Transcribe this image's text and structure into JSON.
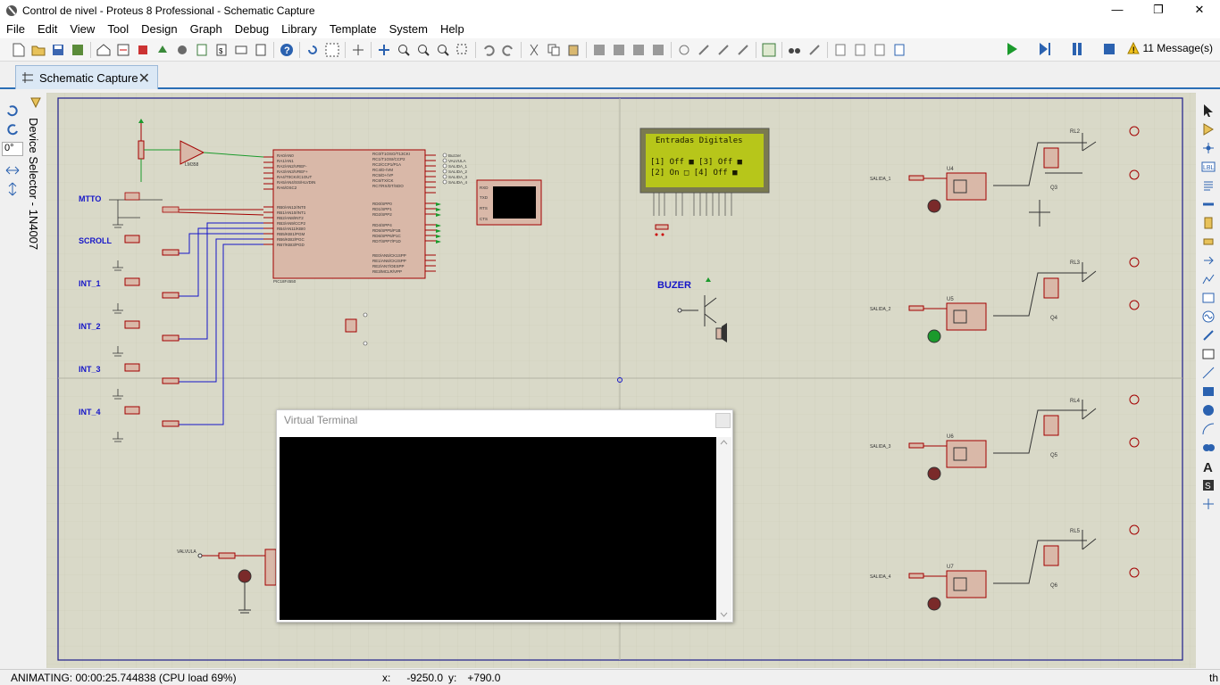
{
  "window": {
    "title": "Control de nivel - Proteus 8 Professional - Schematic Capture",
    "controls": {
      "minimize": "—",
      "restore": "❐",
      "close": "✕"
    }
  },
  "menu": [
    "File",
    "Edit",
    "View",
    "Tool",
    "Design",
    "Graph",
    "Debug",
    "Library",
    "Template",
    "System",
    "Help"
  ],
  "messages": {
    "label": "11 Message(s)"
  },
  "tab": {
    "label": "Schematic Capture"
  },
  "device_selector": {
    "label": "Device Selector - 1N4007"
  },
  "rotation": {
    "value": "0°"
  },
  "schematic": {
    "inputs": [
      "MTTO",
      "SCROLL",
      "INT_1",
      "INT_2",
      "INT_3",
      "INT_4"
    ],
    "buzzer_label": "BUZER",
    "lcd": {
      "line1": "Entradas Digitales",
      "line3": "[1] Off ■  [3] Off ■",
      "line4": "[2] On  □  [4] Off ■"
    },
    "mcu": {
      "name": "PIC18F4550"
    },
    "opamp": {
      "name": "LM358"
    },
    "relays": [
      "RL2",
      "RL3",
      "RL4",
      "RL5"
    ],
    "optos": [
      "U4",
      "U5",
      "U6",
      "U7"
    ],
    "transistors": [
      "Q3",
      "Q4",
      "Q5",
      "Q6"
    ],
    "outputs": [
      "SALIDA_1",
      "SALIDA_2",
      "SALIDA_3",
      "SALIDA_4"
    ],
    "valve": "VALVULA"
  },
  "virtual_terminal": {
    "title": "Virtual Terminal"
  },
  "status": {
    "animating": "ANIMATING: 00:00:25.744838 (CPU load 69%)",
    "x_label": "x:",
    "x_value": "-9250.0",
    "y_label": "y:",
    "y_value": "+790.0",
    "right_text": "th"
  },
  "colors": {
    "canvas": "#d9d9c8",
    "wire": "#a30000",
    "label_blue": "#1515c8",
    "sheet_border": "#1c1c8a"
  }
}
